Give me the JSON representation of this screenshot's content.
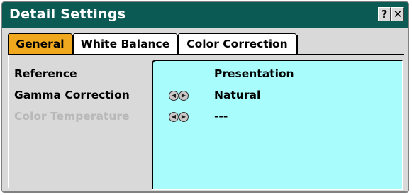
{
  "window": {
    "title": "Detail Settings",
    "help_label": "?",
    "close_label": "✕"
  },
  "tabs": [
    {
      "label": "General",
      "active": true
    },
    {
      "label": "White Balance",
      "active": false
    },
    {
      "label": "Color Correction",
      "active": false
    }
  ],
  "settings": [
    {
      "label": "Reference",
      "value": "Presentation",
      "enabled": true,
      "adjustable": false
    },
    {
      "label": "Gamma Correction",
      "value": "Natural",
      "enabled": true,
      "adjustable": true
    },
    {
      "label": "Color Temperature",
      "value": "---",
      "enabled": false,
      "adjustable": true
    }
  ],
  "arrows": {
    "left": "◀",
    "right": "▶"
  },
  "colors": {
    "title_bar": "#0b5a53",
    "active_tab": "#f0a81f",
    "value_panel": "#a8fcfc",
    "disabled_text": "#b8b8b8"
  }
}
